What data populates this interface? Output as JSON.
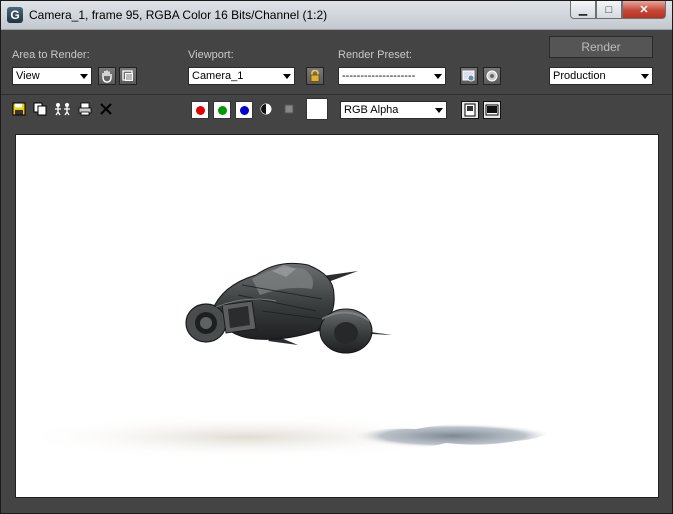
{
  "window": {
    "title": "Camera_1, frame 95, RGBA Color 16 Bits/Channel (1:2)",
    "buttons": {
      "minimize": "▁",
      "maximize": "□",
      "close": "✕"
    }
  },
  "controls": {
    "area_label": "Area to Render:",
    "area_value": "View",
    "viewport_label": "Viewport:",
    "viewport_value": "Camera_1",
    "preset_label": "Render Preset:",
    "preset_value": "--------------------",
    "render_button": "Render",
    "production_value": "Production"
  },
  "toolbar": {
    "channel_value": "RGB Alpha"
  },
  "colors": {
    "red_channel": "#e00000",
    "green_channel": "#009a00",
    "blue_channel": "#0000d0",
    "panel_bg": "#444444"
  },
  "icons": [
    "save-icon",
    "copy-icon",
    "clone-icon",
    "print-icon",
    "clear-icon",
    "lock-icon",
    "hand-icon",
    "crop-icon",
    "environment-icon",
    "gear-icon",
    "mono-icon",
    "channel-display-icon",
    "frame-window-icon"
  ]
}
